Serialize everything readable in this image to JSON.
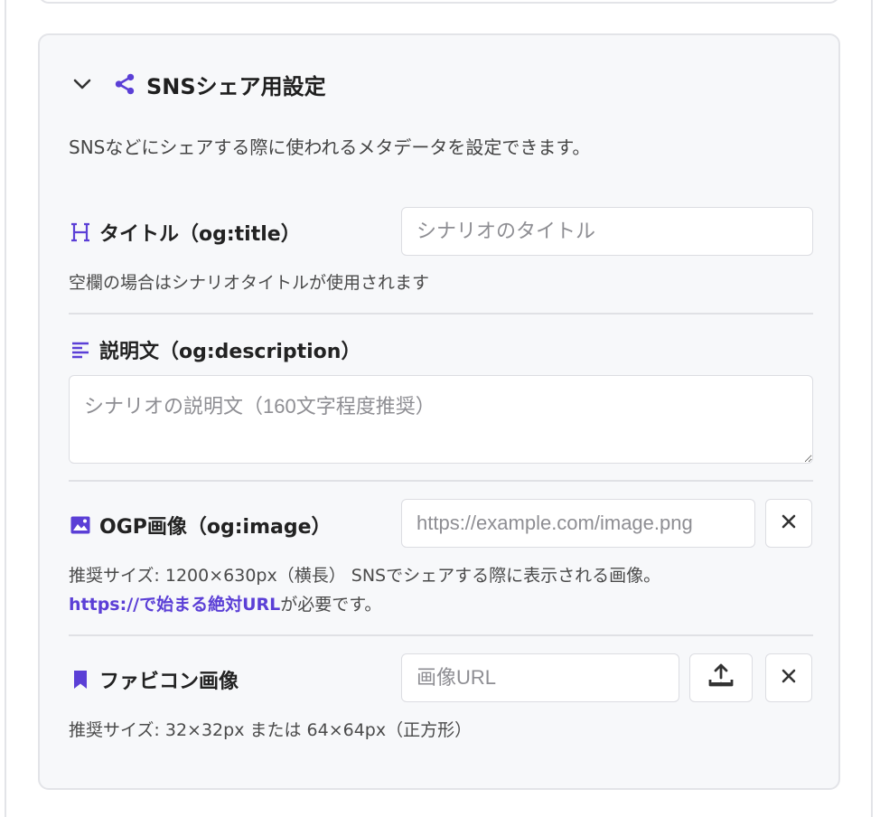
{
  "section": {
    "title": "SNSシェア用設定",
    "description": "SNSなどにシェアする際に使われるメタデータを設定できます。"
  },
  "og_title": {
    "label": "タイトル（og:title）",
    "placeholder": "シナリオのタイトル",
    "value": "",
    "hint": "空欄の場合はシナリオタイトルが使用されます"
  },
  "og_description": {
    "label": "説明文（og:description）",
    "placeholder": "シナリオの説明文（160文字程度推奨）",
    "value": ""
  },
  "og_image": {
    "label": "OGP画像（og:image）",
    "placeholder": "https://example.com/image.png",
    "value": "",
    "hint_line1": "推奨サイズ: 1200×630px（横長） SNSでシェアする際に表示される画像。",
    "hint_strong": "https://で始まる絶対URL",
    "hint_suffix": "が必要です。",
    "clear_label": "×"
  },
  "favicon": {
    "label": "ファビコン画像",
    "placeholder": "画像URL",
    "value": "",
    "hint": "推奨サイズ: 32×32px または 64×64px（正方形）",
    "clear_label": "×"
  },
  "icons": {
    "collapse": "chevron-down-icon",
    "section": "share-icon",
    "title": "heading-icon",
    "description": "align-left-icon",
    "image": "image-icon",
    "favicon": "bookmark-icon",
    "upload": "upload-icon",
    "clear": "close-icon"
  },
  "colors": {
    "accent": "#5b3fd6",
    "card_bg": "#f7f8fa",
    "border": "#dcdde2"
  }
}
